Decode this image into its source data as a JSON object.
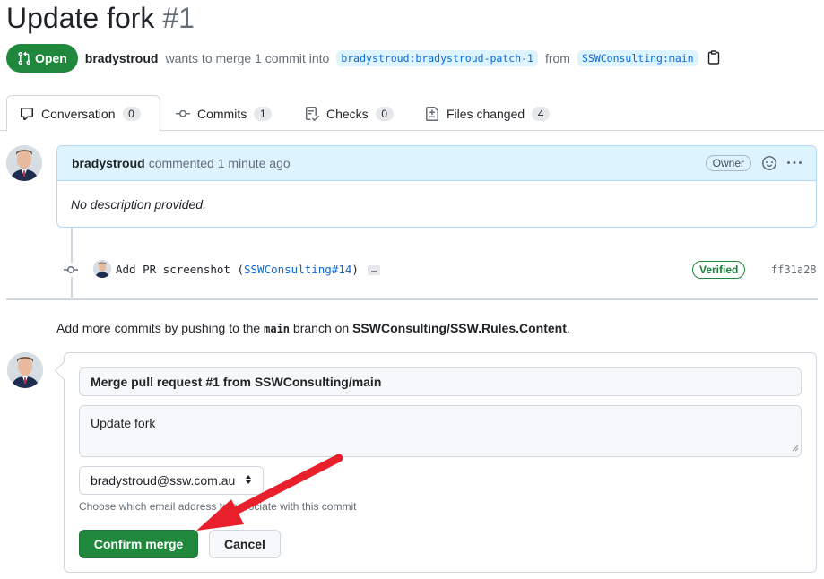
{
  "pr": {
    "title": "Update fork",
    "number": "#1",
    "state": "Open",
    "author": "bradystroud",
    "merge_text": "wants to merge 1 commit into",
    "base_branch": "bradystroud:bradystroud-patch-1",
    "from_text": "from",
    "head_branch": "SSWConsulting:main"
  },
  "tabs": [
    {
      "label": "Conversation",
      "count": "0",
      "icon": "comment-icon"
    },
    {
      "label": "Commits",
      "count": "1",
      "icon": "commit-icon"
    },
    {
      "label": "Checks",
      "count": "0",
      "icon": "checklist-icon"
    },
    {
      "label": "Files changed",
      "count": "4",
      "icon": "file-diff-icon"
    }
  ],
  "comment": {
    "author": "bradystroud",
    "action": "commented 1 minute ago",
    "badge": "Owner",
    "body": "No description provided."
  },
  "commit": {
    "message": "Add PR screenshot (",
    "ref": "SSWConsulting#14",
    "message_end": ")",
    "more": "…",
    "verified": "Verified",
    "sha": "ff31a28"
  },
  "hint": {
    "prefix": "Add more commits by pushing to the",
    "branch": "main",
    "middle": "branch on",
    "repo": "SSWConsulting/SSW.Rules.Content",
    "suffix": "."
  },
  "merge": {
    "commit_title": "Merge pull request #1 from SSWConsulting/main",
    "commit_body": "Update fork",
    "email": "bradystroud@ssw.com.au",
    "email_caption": "Choose which email address to associate with this commit",
    "confirm_label": "Confirm merge",
    "cancel_label": "Cancel"
  },
  "colors": {
    "open_green": "#1f883d",
    "link_blue": "#0969da",
    "annotation_arrow": "#e8202c"
  }
}
